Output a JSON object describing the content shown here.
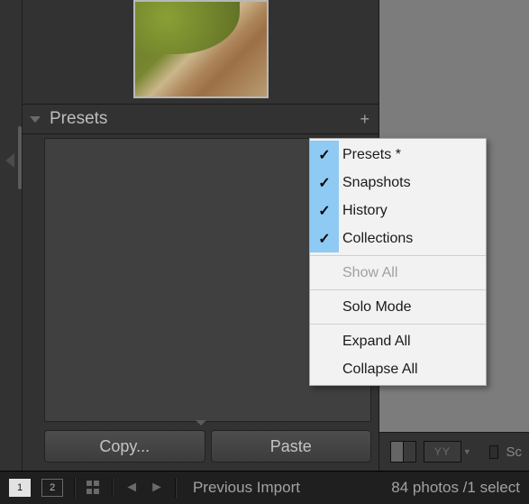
{
  "panel": {
    "title": "Presets",
    "add_icon": "+"
  },
  "buttons": {
    "copy": "Copy...",
    "paste": "Paste"
  },
  "context_menu": {
    "items": [
      {
        "label": "Presets *",
        "checked": true,
        "enabled": true
      },
      {
        "label": "Snapshots",
        "checked": true,
        "enabled": true
      },
      {
        "label": "History",
        "checked": true,
        "enabled": true
      },
      {
        "label": "Collections",
        "checked": true,
        "enabled": true
      }
    ],
    "show_all": "Show All",
    "solo_mode": "Solo Mode",
    "expand_all": "Expand All",
    "collapse_all": "Collapse All"
  },
  "right_bar": {
    "compare_label": "YY",
    "checkbox_label": "Sc"
  },
  "status": {
    "page_1": "1",
    "page_2": "2",
    "source_label": "Previous Import",
    "count_label": "84 photos /1 select"
  }
}
